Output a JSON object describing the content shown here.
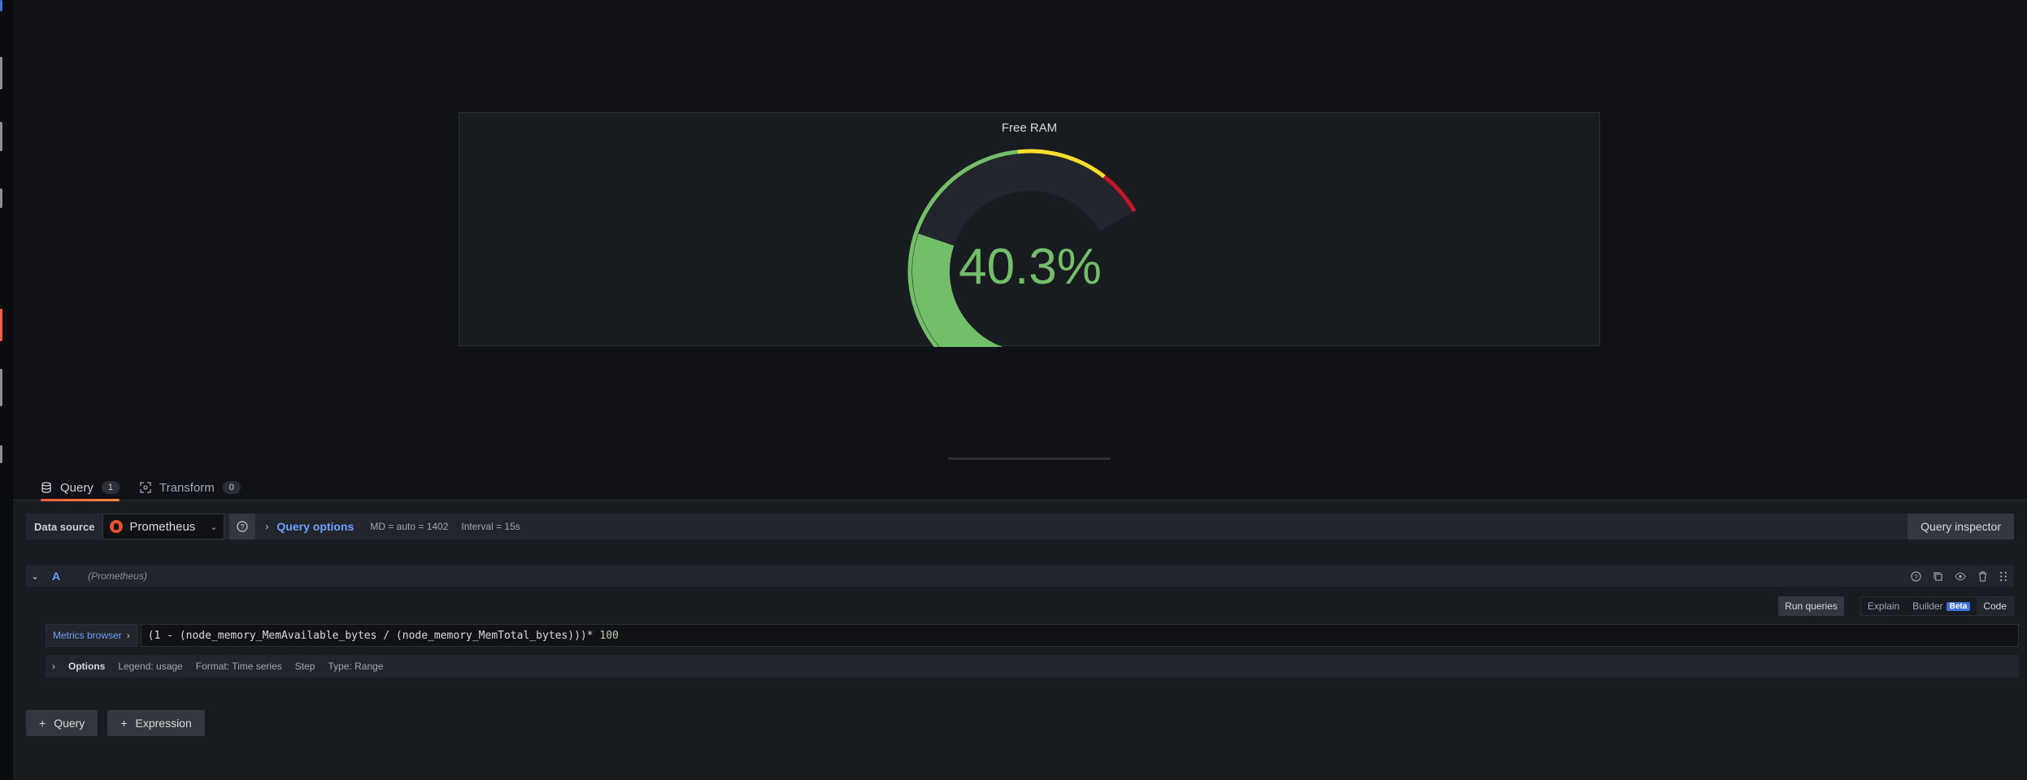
{
  "panel": {
    "title": "Free RAM",
    "gauge": {
      "value": 40.3,
      "display": "40.3%",
      "min": 0,
      "max": 100,
      "thresholds": [
        {
          "from": 0,
          "color": "#73bf69"
        },
        {
          "from": 70,
          "color": "#fade2a"
        },
        {
          "from": 90,
          "color": "#c4162a"
        }
      ],
      "value_color": "#73bf69"
    }
  },
  "tabs": [
    {
      "label": "Query",
      "count": "1",
      "icon": "database-icon"
    },
    {
      "label": "Transform",
      "count": "0",
      "icon": "transform-icon"
    }
  ],
  "datasource": {
    "label": "Data source",
    "selected": "Prometheus",
    "query_options_label": "Query options",
    "md": "MD = auto = 1402",
    "interval": "Interval = 15s",
    "inspector_label": "Query inspector"
  },
  "query": {
    "letter": "A",
    "datasource_hint": "(Prometheus)",
    "run_label": "Run queries",
    "modes": {
      "explain": "Explain",
      "builder": "Builder",
      "beta": "Beta",
      "code": "Code"
    },
    "metrics_browser": "Metrics browser",
    "expr_main": "(1 - (node_memory_MemAvailable_bytes / (node_memory_MemTotal_bytes)))* ",
    "expr_num": "100",
    "options": {
      "title": "Options",
      "legend": "Legend: usage",
      "format": "Format: Time series",
      "step": "Step",
      "type": "Type: Range"
    }
  },
  "buttons": {
    "add_query": "Query",
    "add_expression": "Expression"
  }
}
